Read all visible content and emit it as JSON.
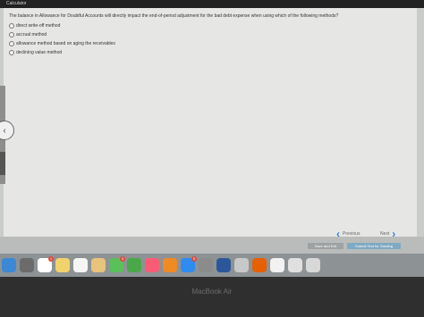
{
  "topbar": {
    "title": "Calculator"
  },
  "question": {
    "text": "The balance in Allowance for Doubtful Accounts will directly impact the end-of-period adjustment for the bad debt expense when using which of the following methods?"
  },
  "options": [
    {
      "label": "direct write-off method"
    },
    {
      "label": "accrual method"
    },
    {
      "label": "allowance method based on aging the receivables"
    },
    {
      "label": "declining value method"
    }
  ],
  "navigation": {
    "previous_label": "Previous",
    "next_label": "Next"
  },
  "actions": {
    "save_label": "Save and Exit",
    "submit_label": "Submit Test for Grading"
  },
  "dock": {
    "icons": [
      {
        "name": "finder-icon",
        "color": "#3b88d6"
      },
      {
        "name": "launchpad-icon",
        "color": "#6b6b6b"
      },
      {
        "name": "calendar-icon",
        "color": "#ffffff",
        "badge": "1"
      },
      {
        "name": "notes-icon",
        "color": "#f1d36b"
      },
      {
        "name": "reminders-icon",
        "color": "#f5f5f5"
      },
      {
        "name": "photos-icon",
        "color": "#e8c37b"
      },
      {
        "name": "messages-icon",
        "color": "#5ac05a",
        "badge": "3"
      },
      {
        "name": "facetime-icon",
        "color": "#4aa84a"
      },
      {
        "name": "music-icon",
        "color": "#fb5c74"
      },
      {
        "name": "books-icon",
        "color": "#f08a24"
      },
      {
        "name": "appstore-icon",
        "color": "#2e8cf0",
        "badge": "5"
      },
      {
        "name": "preferences-icon",
        "color": "#8b8b8b"
      },
      {
        "name": "word-icon",
        "color": "#2b579a"
      },
      {
        "name": "screenshot-icon",
        "color": "#c8c8c8"
      },
      {
        "name": "firefox-icon",
        "color": "#e66000"
      },
      {
        "name": "document-icon",
        "color": "#f2f2f2"
      },
      {
        "name": "folder-icon",
        "color": "#e0e0e0"
      },
      {
        "name": "trash-icon",
        "color": "#d8d8d8"
      }
    ]
  },
  "laptop": {
    "brand": "MacBook Air"
  }
}
